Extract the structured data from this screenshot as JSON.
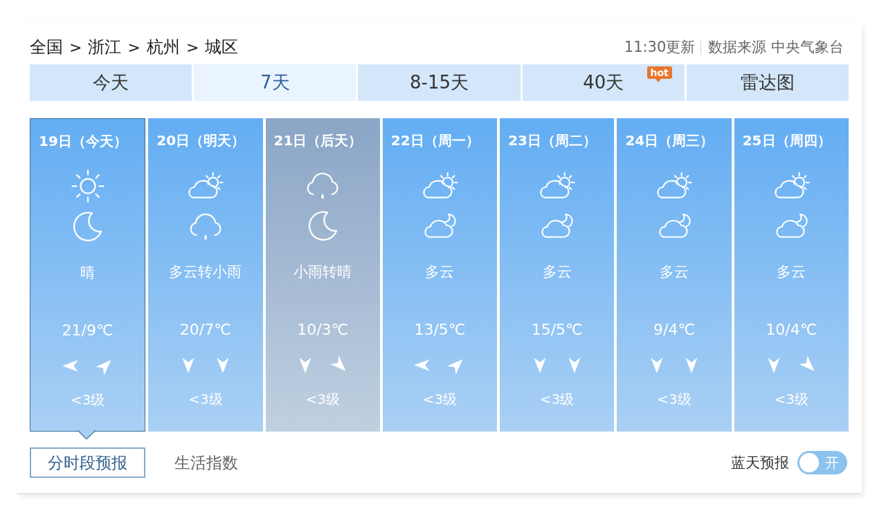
{
  "breadcrumb": [
    {
      "kind": "link",
      "text": "全国"
    },
    {
      "kind": "separator",
      "text": ">"
    },
    {
      "kind": "link",
      "text": "浙江"
    },
    {
      "kind": "separator",
      "text": ">"
    },
    {
      "kind": "link",
      "text": "杭州"
    },
    {
      "kind": "separator",
      "text": ">"
    },
    {
      "kind": "link",
      "text": "城区"
    }
  ],
  "header": {
    "update_time": "11:30更新",
    "source": "数据来源 中央气象台"
  },
  "tabs": [
    {
      "label": "今天",
      "selected": false
    },
    {
      "label": "7天",
      "selected": true
    },
    {
      "label": "8-15天",
      "selected": false
    },
    {
      "label": "40天",
      "selected": false,
      "badge": "hot"
    },
    {
      "label": "雷达图",
      "selected": false
    }
  ],
  "days": [
    {
      "date": "19日（今天）",
      "selected": true,
      "highlighted": false,
      "icons": [
        {
          "kind": "sun"
        },
        {
          "kind": "moon"
        }
      ],
      "weather": "晴",
      "temp": "21/9℃",
      "winds": [
        {
          "kind": "left"
        },
        {
          "kind": "up-right"
        }
      ],
      "wind_level": "<3级"
    },
    {
      "date": "20日（明天）",
      "selected": false,
      "highlighted": false,
      "icons": [
        {
          "kind": "cloud-sun"
        },
        {
          "kind": "cloud-rain"
        }
      ],
      "weather": "多云转小雨",
      "temp": "20/7℃",
      "winds": [
        {
          "kind": "down"
        },
        {
          "kind": "down"
        }
      ],
      "wind_level": "<3级"
    },
    {
      "date": "21日（后天）",
      "selected": false,
      "highlighted": true,
      "icons": [
        {
          "kind": "cloud-rain"
        },
        {
          "kind": "moon"
        }
      ],
      "weather": "小雨转晴",
      "temp": "10/3℃",
      "winds": [
        {
          "kind": "down"
        },
        {
          "kind": "down-right"
        }
      ],
      "wind_level": "<3级"
    },
    {
      "date": "22日（周一）",
      "selected": false,
      "highlighted": false,
      "icons": [
        {
          "kind": "cloud-sun"
        },
        {
          "kind": "cloud-moon"
        }
      ],
      "weather": "多云",
      "temp": "13/5℃",
      "winds": [
        {
          "kind": "left"
        },
        {
          "kind": "up-right"
        }
      ],
      "wind_level": "<3级"
    },
    {
      "date": "23日（周二）",
      "selected": false,
      "highlighted": false,
      "icons": [
        {
          "kind": "cloud-sun"
        },
        {
          "kind": "cloud-moon"
        }
      ],
      "weather": "多云",
      "temp": "15/5℃",
      "winds": [
        {
          "kind": "down"
        },
        {
          "kind": "down"
        }
      ],
      "wind_level": "<3级"
    },
    {
      "date": "24日（周三）",
      "selected": false,
      "highlighted": false,
      "icons": [
        {
          "kind": "cloud-sun"
        },
        {
          "kind": "cloud-moon"
        }
      ],
      "weather": "多云",
      "temp": "9/4℃",
      "winds": [
        {
          "kind": "down"
        },
        {
          "kind": "down"
        }
      ],
      "wind_level": "<3级"
    },
    {
      "date": "25日（周四）",
      "selected": false,
      "highlighted": false,
      "icons": [
        {
          "kind": "cloud-sun"
        },
        {
          "kind": "cloud-moon"
        }
      ],
      "weather": "多云",
      "temp": "10/4℃",
      "winds": [
        {
          "kind": "down"
        },
        {
          "kind": "down-right"
        }
      ],
      "wind_level": "<3级"
    }
  ],
  "bottom": {
    "tabs": [
      {
        "label": "分时段预报",
        "selected": true
      },
      {
        "label": "生活指数",
        "selected": false
      }
    ],
    "blue_sky": {
      "label": "蓝天预报",
      "on": false,
      "state_text": "开"
    }
  }
}
